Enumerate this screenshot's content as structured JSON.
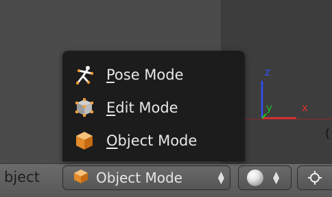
{
  "header": {
    "context_label": "bject"
  },
  "mode_select": {
    "selected": "Object Mode",
    "icon": "cube-icon"
  },
  "mode_menu": {
    "items": [
      {
        "accel": "P",
        "rest": "ose Mode",
        "icon": "pose-armature-icon"
      },
      {
        "accel": "E",
        "rest": "dit Mode",
        "icon": "edit-mesh-icon"
      },
      {
        "accel": "O",
        "rest": "bject Mode",
        "icon": "cube-icon"
      }
    ]
  },
  "shading_select": {
    "icon": "solid-sphere-icon"
  },
  "pivot_button": {
    "icon": "pivot-center-icon"
  },
  "axes": {
    "z": "z",
    "y": "y",
    "x": "x",
    "colors": {
      "z": "#3050ff",
      "y": "#20c020",
      "x": "#e03030"
    }
  },
  "edge_glyph": "("
}
